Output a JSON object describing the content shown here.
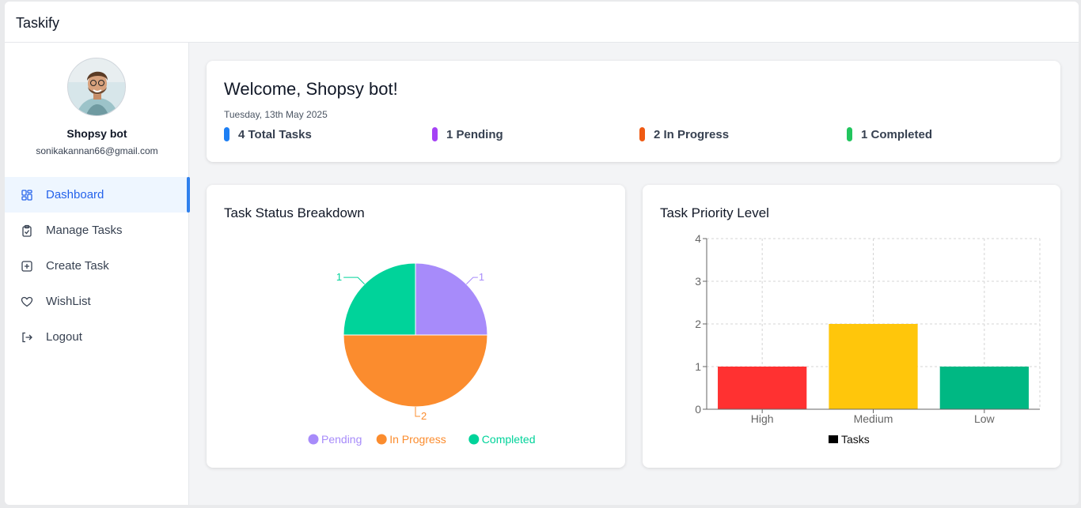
{
  "app": {
    "title": "Taskify"
  },
  "user": {
    "name": "Shopsy bot",
    "email": "sonikakannan66@gmail.com"
  },
  "menu": {
    "items": [
      {
        "label": "Dashboard",
        "icon": "dashboard-icon",
        "active": true
      },
      {
        "label": "Manage Tasks",
        "icon": "clipboard-check-icon"
      },
      {
        "label": "Create Task",
        "icon": "plus-square-icon"
      },
      {
        "label": "WishList",
        "icon": "heart-icon"
      },
      {
        "label": "Logout",
        "icon": "logout-icon"
      }
    ]
  },
  "welcome": {
    "greeting": "Welcome, Shopsy bot!",
    "date": "Tuesday, 13th May 2025",
    "stats": [
      {
        "label": "4 Total Tasks",
        "color": "#1d7ff4"
      },
      {
        "label": "1 Pending",
        "color": "#a542f5"
      },
      {
        "label": "2 In Progress",
        "color": "#ef5a13"
      },
      {
        "label": "1 Completed",
        "color": "#22c55e"
      }
    ]
  },
  "status_chart": {
    "title": "Task Status Breakdown"
  },
  "priority_chart": {
    "title": "Task Priority Level"
  },
  "chart_data": [
    {
      "type": "pie",
      "title": "Task Status Breakdown",
      "categories": [
        "Pending",
        "In Progress",
        "Completed"
      ],
      "values": [
        1,
        2,
        1
      ],
      "colors": [
        "#a78bfa",
        "#fb8c2e",
        "#00d39a"
      ],
      "legend": "bottom"
    },
    {
      "type": "bar",
      "title": "Task Priority Level",
      "categories": [
        "High",
        "Medium",
        "Low"
      ],
      "series": [
        {
          "name": "Tasks",
          "values": [
            1,
            2,
            1
          ]
        }
      ],
      "colors": [
        "#ff3131",
        "#ffc60b",
        "#00b883"
      ],
      "ylim": [
        0,
        4
      ],
      "yticks": [
        0,
        1,
        2,
        3,
        4
      ],
      "grid": true,
      "legend": "bottom"
    }
  ]
}
